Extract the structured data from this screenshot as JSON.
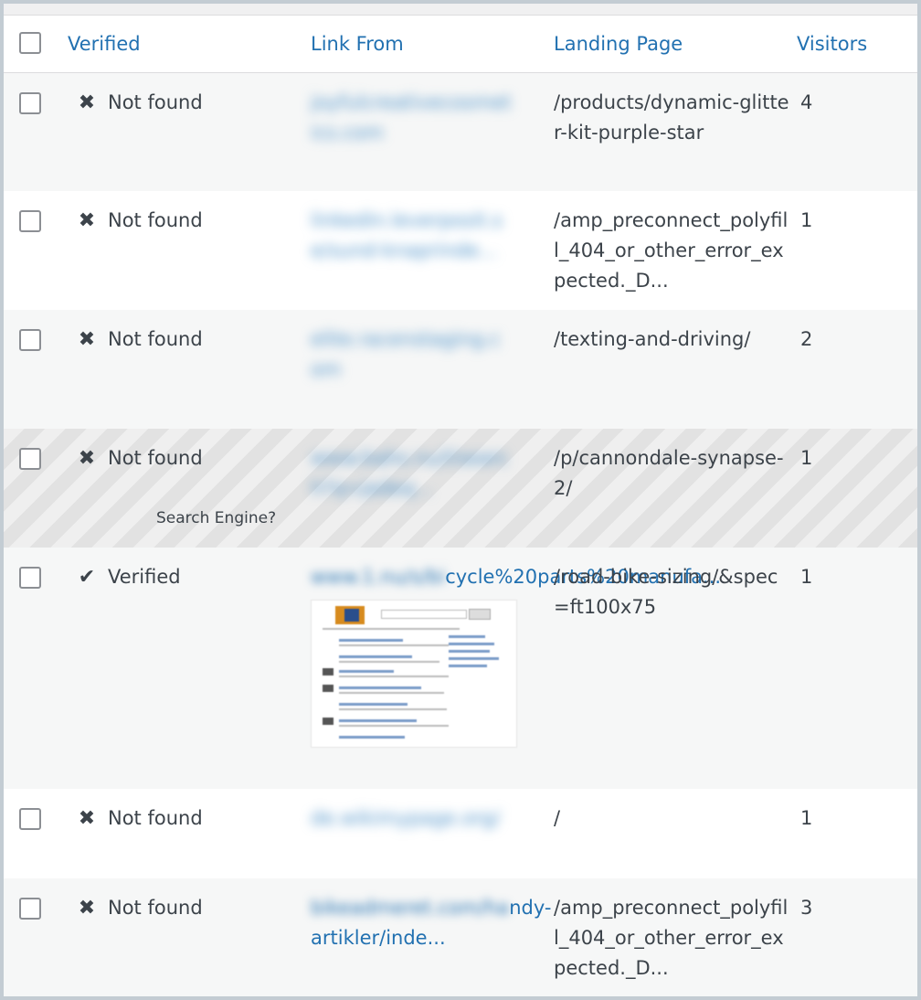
{
  "columns": {
    "verified": "Verified",
    "link_from": "Link From",
    "landing_page": "Landing Page",
    "visitors": "Visitors"
  },
  "rows": [
    {
      "status": "Not found",
      "status_icon": "x-icon",
      "link_from": "joyfulcreativecosmetics.com",
      "link_blurred": true,
      "landing_page": "/products/dynamic-glitter-kit-purple-star",
      "visitors": "4"
    },
    {
      "status": "Not found",
      "status_icon": "x-icon",
      "link_from": "linkedin.leverposit.se/sund-knaprinde...",
      "link_blurred": true,
      "landing_page": "/amp_preconnect_polyfill_404_or_other_error_expected._D...",
      "visitors": "1"
    },
    {
      "status": "Not found",
      "status_icon": "x-icon",
      "link_from": "elite.racenstaging.com",
      "link_blurred": true,
      "landing_page": "/texting-and-driving/",
      "visitors": "2"
    },
    {
      "status": "Not found",
      "status_icon": "x-icon",
      "hint": "Search Engine?",
      "link_from": "www.bahs.nu/l/search?q=jadeq...",
      "link_blurred": true,
      "landing_page": "/p/cannondale-synapse-2/",
      "visitors": "1"
    },
    {
      "status": "Verified",
      "status_icon": "check-icon",
      "link_from_blurred_part": "www.1.nu/s/bi",
      "link_from_visible_part": "cycle%20parts%20manufa...",
      "landing_page": "/road-bike-sizing/&spec=ft100x75",
      "visitors": "1",
      "has_thumbnail": true
    },
    {
      "status": "Not found",
      "status_icon": "x-icon",
      "link_from": "de.wikimypage.org/",
      "link_blurred": true,
      "landing_page": "/",
      "visitors": "1"
    },
    {
      "status": "Not found",
      "status_icon": "x-icon",
      "link_from_blurred_part": "bikeadmeret.com/ha",
      "link_from_visible_part": "ndy-artikler/inde...",
      "landing_page": "/amp_preconnect_polyfill_404_or_other_error_expected._D...",
      "visitors": "3"
    }
  ],
  "icons": {
    "not_found": "✖",
    "verified": "✔"
  },
  "colors": {
    "link": "#2271b1",
    "text": "#3c434a",
    "header_bg": "#ffffff",
    "row_alt": "#f6f7f7"
  }
}
